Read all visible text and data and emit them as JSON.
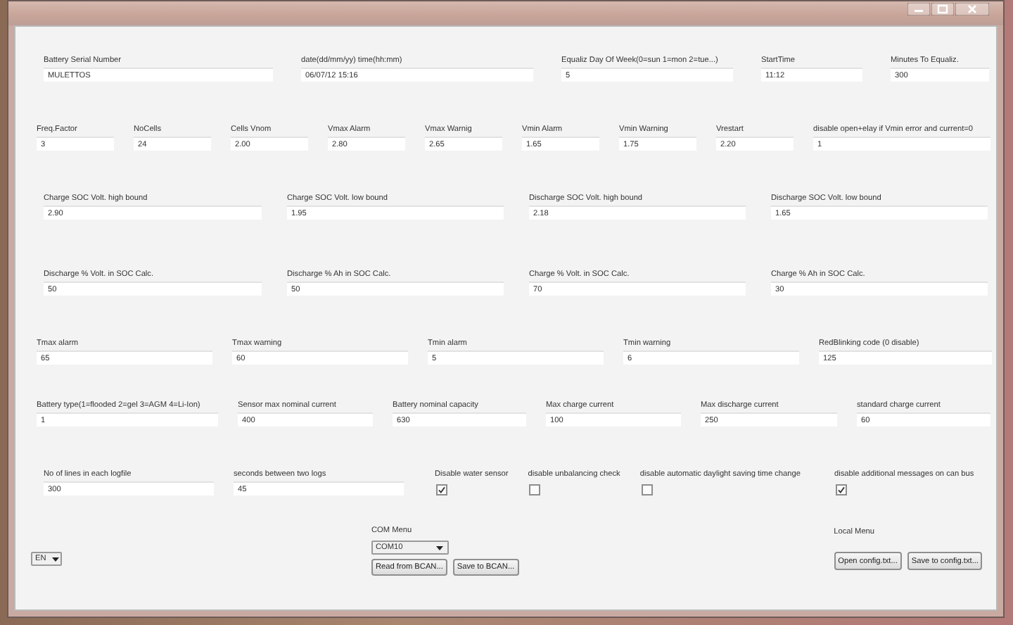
{
  "window": {
    "caption_buttons": [
      {
        "kind": "minimize"
      },
      {
        "kind": "maximize"
      },
      {
        "kind": "close"
      }
    ]
  },
  "rows": [
    {
      "fields": [
        {
          "kind": "text",
          "label": "Battery Serial Number",
          "value": "MULETTOS"
        },
        {
          "kind": "text",
          "label": "date(dd/mm/yy) time(hh:mm)",
          "value": "06/07/12 15:16"
        },
        {
          "kind": "text",
          "label": "Equaliz Day Of Week(0=sun 1=mon 2=tue...)",
          "value": "5"
        },
        {
          "kind": "text",
          "label": "StartTime",
          "value": "11:12"
        },
        {
          "kind": "text",
          "label": "Minutes To Equaliz.",
          "value": "300"
        }
      ]
    },
    {
      "fields": [
        {
          "kind": "text",
          "label": "Freq.Factor",
          "value": "3"
        },
        {
          "kind": "text",
          "label": "NoCells",
          "value": "24"
        },
        {
          "kind": "text",
          "label": "Cells Vnom",
          "value": "2.00"
        },
        {
          "kind": "text",
          "label": "Vmax Alarm",
          "value": "2.80"
        },
        {
          "kind": "text",
          "label": "Vmax Warnig",
          "value": "2.65"
        },
        {
          "kind": "text",
          "label": "Vmin Alarm",
          "value": "1.65"
        },
        {
          "kind": "text",
          "label": "Vmin Warning",
          "value": "1.75"
        },
        {
          "kind": "text",
          "label": "Vrestart",
          "value": "2.20"
        },
        {
          "kind": "text",
          "label": "disable open+elay if Vmin error and current=0",
          "value": "1"
        }
      ]
    },
    {
      "fields": [
        {
          "kind": "text",
          "label": "Charge SOC Volt. high bound",
          "value": "2.90"
        },
        {
          "kind": "text",
          "label": "Charge SOC Volt. low bound",
          "value": "1.95"
        },
        {
          "kind": "text",
          "label": "Discharge SOC Volt. high bound",
          "value": "2.18"
        },
        {
          "kind": "text",
          "label": "Discharge SOC Volt. low bound",
          "value": "1.65"
        }
      ]
    },
    {
      "fields": [
        {
          "kind": "text",
          "label": "Discharge % Volt. in SOC Calc.",
          "value": "50"
        },
        {
          "kind": "text",
          "label": "Discharge % Ah in SOC Calc.",
          "value": "50"
        },
        {
          "kind": "text",
          "label": "Charge % Volt. in SOC Calc.",
          "value": "70"
        },
        {
          "kind": "text",
          "label": "Charge % Ah in SOC Calc.",
          "value": "30"
        }
      ]
    },
    {
      "fields": [
        {
          "kind": "text",
          "label": "Tmax alarm",
          "value": "65"
        },
        {
          "kind": "text",
          "label": "Tmax warning",
          "value": "60"
        },
        {
          "kind": "text",
          "label": "Tmin alarm",
          "value": "5"
        },
        {
          "kind": "text",
          "label": "Tmin warning",
          "value": "6"
        },
        {
          "kind": "text",
          "label": "RedBlinking code (0 disable)",
          "value": "125"
        }
      ]
    },
    {
      "fields": [
        {
          "kind": "text",
          "label": "Battery type(1=flooded 2=gel 3=AGM 4=Li-Ion)",
          "value": "1"
        },
        {
          "kind": "text",
          "label": "Sensor max nominal current",
          "value": "400"
        },
        {
          "kind": "text",
          "label": "Battery nominal capacity",
          "value": "630"
        },
        {
          "kind": "text",
          "label": "Max charge current",
          "value": "100"
        },
        {
          "kind": "text",
          "label": "Max discharge current",
          "value": "250"
        },
        {
          "kind": "text",
          "label": "standard charge current",
          "value": "60"
        }
      ]
    },
    {
      "fields": [
        {
          "kind": "text",
          "label": "No of lines in each logfile",
          "value": "300"
        },
        {
          "kind": "text",
          "label": "seconds between two logs",
          "value": "45"
        },
        {
          "kind": "checkbox",
          "label": "Disable water sensor",
          "checked": true
        },
        {
          "kind": "checkbox",
          "label": "disable unbalancing check",
          "checked": false
        },
        {
          "kind": "checkbox",
          "label": "disable automatic daylight saving time change",
          "checked": false
        },
        {
          "kind": "checkbox",
          "label": "disable additional messages on can bus",
          "checked": true
        }
      ]
    }
  ],
  "language": {
    "value": "EN"
  },
  "com_menu": {
    "label": "COM Menu",
    "port": "COM10",
    "buttons": [
      "Read from BCAN...",
      "Save to BCAN..."
    ]
  },
  "local_menu": {
    "label": "Local Menu",
    "buttons": [
      "Open config.txt...",
      "Save to config.txt..."
    ]
  }
}
